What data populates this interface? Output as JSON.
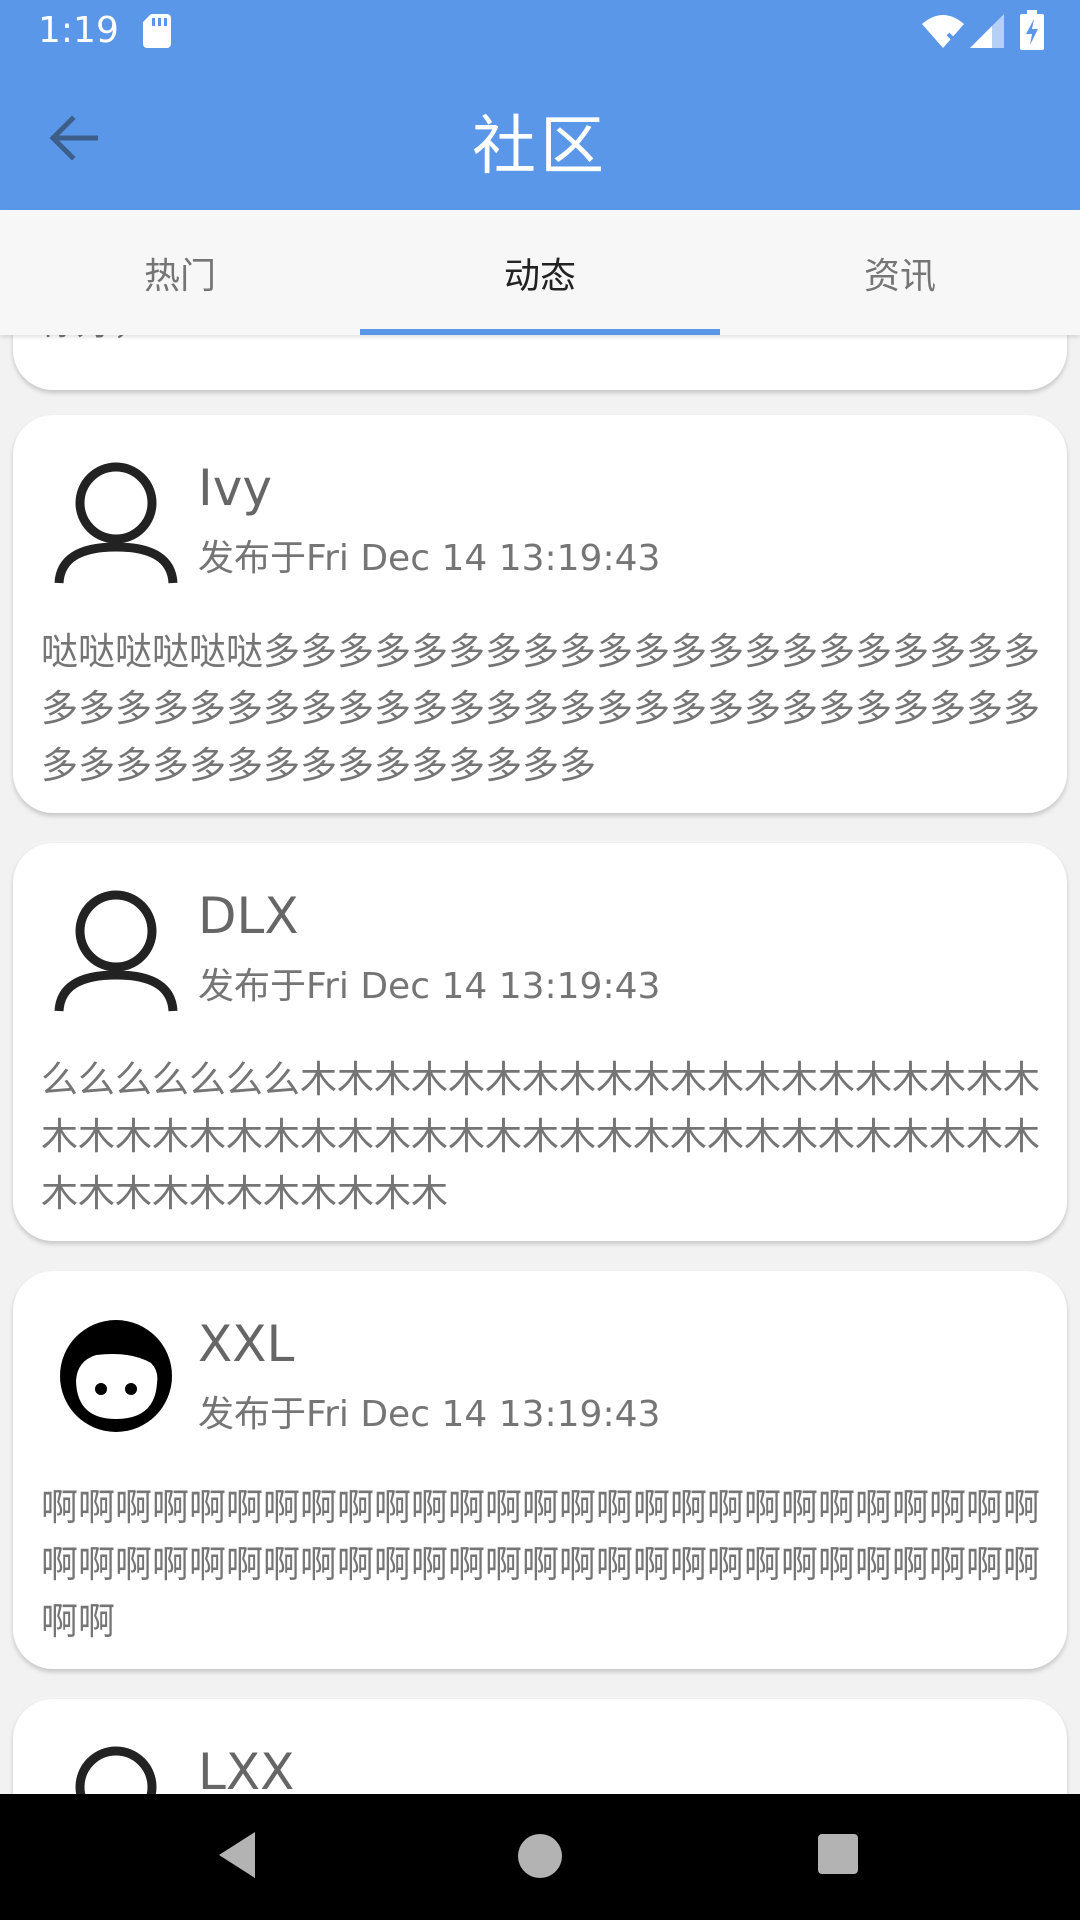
{
  "status_bar": {
    "time": "1:19",
    "icons": [
      "sd-card-icon",
      "wifi-icon",
      "signal-icon",
      "battery-charging-icon"
    ]
  },
  "app_bar": {
    "title": "社区",
    "back_icon": "arrow-left-icon",
    "background": "#5b97e9"
  },
  "tabs": [
    {
      "label": "热门",
      "active": false
    },
    {
      "label": "动态",
      "active": true
    },
    {
      "label": "资讯",
      "active": false
    }
  ],
  "feed": {
    "previous_card_text": "你好，android",
    "posts": [
      {
        "name": "Ivy",
        "time": "发布于Fri Dec 14 13:19:43",
        "avatar": "person-outline-icon",
        "body": "哒哒哒哒哒哒多多多多多多多多多多多多多多多多多多多多多多多多多多多多多多多多多多多多多多多多多多多多多多多多多多多多多多多多多多多多多多多"
      },
      {
        "name": "DLX",
        "time": "发布于Fri Dec 14 13:19:43",
        "avatar": "person-outline-icon",
        "body": "么么么么么么么木木木木木木木木木木木木木木木木木木木木木木木木木木木木木木木木木木木木木木木木木木木木木木木木木木木木木木木木木木"
      },
      {
        "name": "XXL",
        "time": "发布于Fri Dec 14 13:19:43",
        "avatar": "face-icon",
        "body": "啊啊啊啊啊啊啊啊啊啊啊啊啊啊啊啊啊啊啊啊啊啊啊啊啊啊啊啊啊啊啊啊啊啊啊啊啊啊啊啊啊啊啊啊啊啊啊啊啊啊啊啊啊啊啊啊"
      },
      {
        "name": "LXX",
        "avatar": "person-outline-icon"
      }
    ]
  },
  "nav_bar": {
    "icons": [
      "nav-back-icon",
      "nav-home-icon",
      "nav-recents-icon"
    ]
  }
}
